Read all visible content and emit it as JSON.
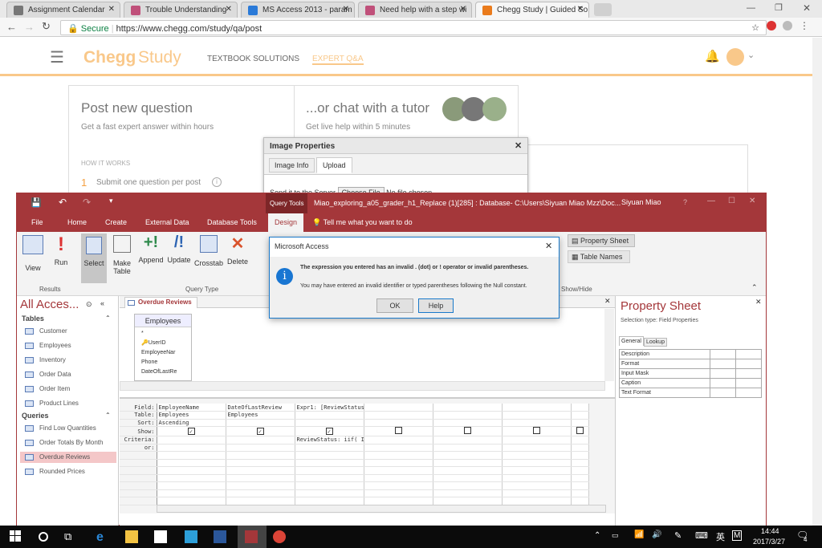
{
  "browser": {
    "tabs": [
      {
        "label": "Assignment Calendar",
        "color": "#777"
      },
      {
        "label": "Trouble Understanding",
        "color": "#c0507a"
      },
      {
        "label": "MS Access 2013 - param",
        "color": "#2a7ad8"
      },
      {
        "label": "Need help with a step wi",
        "color": "#c0507a"
      },
      {
        "label": "Chegg Study | Guided So",
        "color": "#ea7b1c"
      }
    ],
    "secure": "Secure",
    "url": "https://www.chegg.com/study/qa/post"
  },
  "chegg": {
    "logo_chegg": "Chegg",
    "logo_study": "Study",
    "nav": [
      "TEXTBOOK SOLUTIONS",
      "EXPERT Q&A"
    ],
    "post_title": "Post new question",
    "post_sub": "Get a fast expert answer within hours",
    "chat_title": "...or chat with a tutor",
    "chat_sub": "Get live help within 5 minutes",
    "how": "HOW IT WORKS",
    "step_num": "1",
    "step_text": "Submit one question per post",
    "orange": "#f5a142"
  },
  "image_props": {
    "title": "Image Properties",
    "tabs": [
      "Image Info",
      "Upload"
    ],
    "send_label": "Send it to the Server",
    "choose": "Choose File",
    "no_file": "No file chosen"
  },
  "access": {
    "query_tools": "Query Tools",
    "title": "Miao_exploring_a05_grader_h1_Replace (1)[285] : Database- C:\\Users\\Siyuan Miao Mzz\\Doc...",
    "user": "Siyuan Miao",
    "help": "?",
    "tabs": [
      "File",
      "Home",
      "Create",
      "External Data",
      "Database Tools",
      "Design"
    ],
    "tell_me": "Tell me what you want to do",
    "ribbon": {
      "view": "View",
      "run": "Run",
      "select": "Select",
      "make_table": "Make Table",
      "append": "Append",
      "update": "Update",
      "crosstab": "Crosstab",
      "delete": "Delete",
      "property_sheet": "Property Sheet",
      "table_names": "Table Names",
      "group_results": "Results",
      "group_query_type": "Query Type",
      "group_show_hide": "Show/Hide"
    },
    "nav": {
      "title": "All Acces...",
      "tables_label": "Tables",
      "tables": [
        "Customer",
        "Employees",
        "Inventory",
        "Order Data",
        "Order Item",
        "Product Lines"
      ],
      "queries_label": "Queries",
      "queries": [
        "Find Low Quantities",
        "Order Totals By Month",
        "Overdue Reviews",
        "Rounded Prices"
      ],
      "selected": "Overdue Reviews"
    },
    "doc_tab": "Overdue Reviews",
    "table_box": {
      "title": "Employees",
      "fields": [
        "*",
        "UserID",
        "EmployeeNar",
        "Phone",
        "DateOfLastRe"
      ]
    },
    "grid": {
      "row_labels": [
        "Field:",
        "Table:",
        "Sort:",
        "Show:",
        "Criteria:",
        "or:"
      ],
      "columns": [
        {
          "field": "EmployeeName",
          "table": "Employees",
          "sort": "Ascending",
          "show": true,
          "criteria": ""
        },
        {
          "field": "DateOfLastReview",
          "table": "Employees",
          "sort": "",
          "show": true,
          "criteria": ""
        },
        {
          "field": "Expr1: [ReviewStatus]",
          "table": "",
          "sort": "",
          "show": true,
          "criteria": "ReviewStatus: iif( I:"
        },
        {
          "field": "",
          "table": "",
          "sort": "",
          "show": false,
          "criteria": ""
        },
        {
          "field": "",
          "table": "",
          "sort": "",
          "show": false,
          "criteria": ""
        },
        {
          "field": "",
          "table": "",
          "sort": "",
          "show": false,
          "criteria": ""
        },
        {
          "field": "",
          "table": "",
          "sort": "",
          "show": false,
          "criteria": ""
        }
      ]
    },
    "property_sheet": {
      "title": "Property Sheet",
      "selection": "Selection type: Field Properties",
      "tabs": [
        "General",
        "Lookup"
      ],
      "rows": [
        "Description",
        "Format",
        "Input Mask",
        "Caption",
        "Text Format"
      ]
    },
    "accent": "#a4373a"
  },
  "msgbox": {
    "title": "Microsoft Access",
    "main": "The expression you entered has an invalid . (dot) or ! operator or invalid parentheses.",
    "sub": "You may have entered an invalid identifier or typed parentheses following the Null constant.",
    "ok": "OK",
    "help": "Help"
  },
  "taskbar": {
    "time": "14:44",
    "date": "2017/3/27",
    "ime": "英",
    "ime2": "M",
    "notifications": "4"
  }
}
